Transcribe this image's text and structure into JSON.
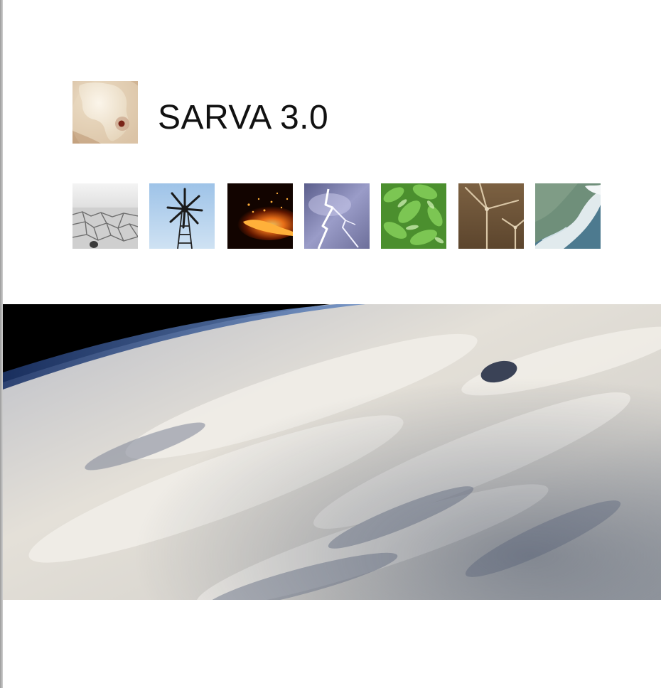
{
  "document": {
    "title": "SARVA 3.0"
  },
  "logo": {
    "icon": "africa-globe-logo-icon",
    "colors": {
      "background": "#d8c0a0",
      "land": "#f3e9d8",
      "marker": "#7a2418"
    }
  },
  "thumbnails": [
    {
      "icon": "drought-cracked-earth-icon",
      "colors": [
        "#eeeeee",
        "#8a8a8a"
      ]
    },
    {
      "icon": "windmill-icon",
      "colors": [
        "#a8c9ea",
        "#1a1a1a"
      ]
    },
    {
      "icon": "fire-icon",
      "colors": [
        "#150500",
        "#ff8a1e"
      ]
    },
    {
      "icon": "lightning-icon",
      "colors": [
        "#6b6f9c",
        "#e8e8ff"
      ]
    },
    {
      "icon": "green-leaves-icon",
      "colors": [
        "#5fae3e",
        "#bfe5a0"
      ]
    },
    {
      "icon": "wind-turbines-icon",
      "colors": [
        "#6b5236",
        "#d6c2a2"
      ]
    },
    {
      "icon": "coastline-satellite-icon",
      "colors": [
        "#4d7a8f",
        "#e9f0f2"
      ]
    }
  ],
  "banner": {
    "icon": "earth-clouds-from-space-icon",
    "colors": {
      "space": "#000000",
      "atmosphere": "#3d5a8a",
      "clouds": "#e4e0d8",
      "shadow": "#5c6478"
    }
  }
}
